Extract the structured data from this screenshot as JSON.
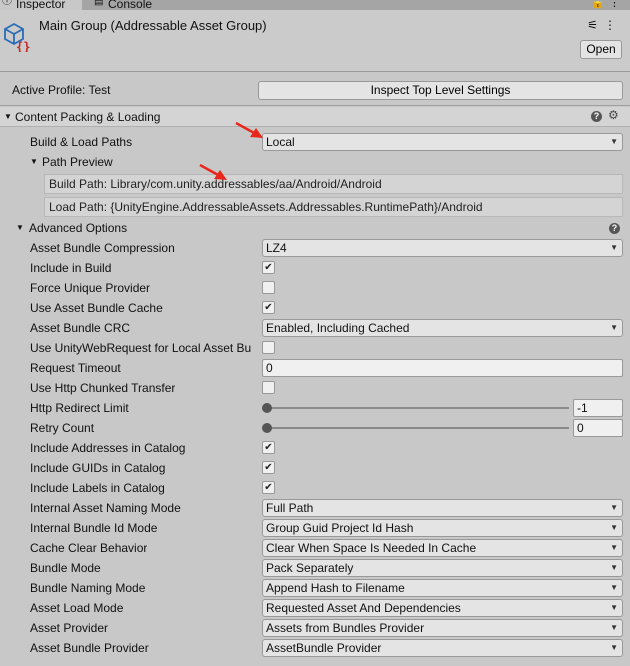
{
  "tabs": {
    "inspector": "Inspector",
    "console": "Console"
  },
  "header": {
    "title": "Main Group (Addressable Asset Group)",
    "open_label": "Open"
  },
  "profile": {
    "label": "Active Profile: Test",
    "inspect_button": "Inspect Top Level Settings"
  },
  "content": {
    "section_title": "Content Packing & Loading",
    "build_load_paths": {
      "label": "Build & Load Paths",
      "value": "Local"
    },
    "path_preview": {
      "title": "Path Preview",
      "build_path": "Build Path: Library/com.unity.addressables/aa/Android/Android",
      "load_path": "Load Path: {UnityEngine.AddressableAssets.Addressables.RuntimePath}/Android"
    },
    "advanced": {
      "title": "Advanced Options",
      "asset_bundle_compression": {
        "label": "Asset Bundle Compression",
        "value": "LZ4"
      },
      "include_in_build": {
        "label": "Include in Build",
        "checked": "✔"
      },
      "force_unique_provider": {
        "label": "Force Unique Provider",
        "checked": ""
      },
      "use_asset_bundle_cache": {
        "label": "Use Asset Bundle Cache",
        "checked": "✔"
      },
      "asset_bundle_crc": {
        "label": "Asset Bundle CRC",
        "value": "Enabled, Including Cached"
      },
      "use_unity_web_request": {
        "label": "Use UnityWebRequest for Local Asset Bu",
        "checked": ""
      },
      "request_timeout": {
        "label": "Request Timeout",
        "value": "0"
      },
      "use_http_chunked": {
        "label": "Use Http Chunked Transfer",
        "checked": ""
      },
      "http_redirect_limit": {
        "label": "Http Redirect Limit",
        "value": "-1"
      },
      "retry_count": {
        "label": "Retry Count",
        "value": "0"
      },
      "include_addresses": {
        "label": "Include Addresses in Catalog",
        "checked": "✔"
      },
      "include_guids": {
        "label": "Include GUIDs in Catalog",
        "checked": "✔"
      },
      "include_labels": {
        "label": "Include Labels in Catalog",
        "checked": "✔"
      },
      "internal_asset_naming": {
        "label": "Internal Asset Naming Mode",
        "value": "Full Path"
      },
      "internal_bundle_id": {
        "label": "Internal Bundle Id Mode",
        "value": "Group Guid Project Id Hash"
      },
      "cache_clear": {
        "label": "Cache Clear Behavior",
        "value": "Clear When Space Is Needed In Cache"
      },
      "bundle_mode": {
        "label": "Bundle Mode",
        "value": "Pack Separately"
      },
      "bundle_naming": {
        "label": "Bundle Naming Mode",
        "value": "Append Hash to Filename"
      },
      "asset_load_mode": {
        "label": "Asset Load Mode",
        "value": "Requested Asset And Dependencies"
      },
      "asset_provider": {
        "label": "Asset Provider",
        "value": "Assets from Bundles Provider"
      },
      "asset_bundle_provider": {
        "label": "Asset Bundle Provider",
        "value": "AssetBundle Provider"
      }
    }
  },
  "icons": {
    "tab_inspector": "info-icon",
    "tab_console": "console-icon",
    "asset": "addressable-group-icon",
    "settings": "settings-sliders-icon",
    "help": "help-icon",
    "gear": "gear-icon"
  },
  "colors": {
    "background": "#c8c8c8",
    "annotation_arrow": "#e8261b"
  }
}
